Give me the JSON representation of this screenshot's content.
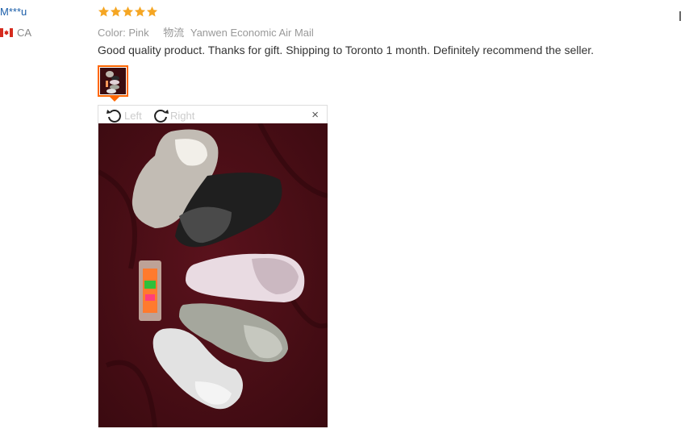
{
  "reviewer": {
    "name": "M***u",
    "country_code": "CA",
    "flag_icon": "canada-flag-icon"
  },
  "review": {
    "rating": 5,
    "rating_max": 5,
    "star_color": "#f5a623",
    "color_label": "Color:",
    "color_value": "Pink",
    "logistics_label": "物流",
    "shipping_method": "Yanwen Economic Air Mail",
    "text": "Good quality product. Thanks for gift. Shipping to Toronto 1 month. Definitely recommend the seller."
  },
  "image_viewer": {
    "rotate_left_label": "Left",
    "rotate_right_label": "Right",
    "close_label": "×",
    "rotate_left_icon": "rotate-left-icon",
    "rotate_right_icon": "rotate-right-icon",
    "close_icon": "close-icon"
  },
  "colors": {
    "accent": "#ff6600",
    "link": "#1b5ea9",
    "photo_background": "#4a0f16"
  }
}
